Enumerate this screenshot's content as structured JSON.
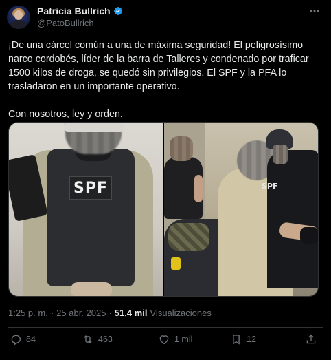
{
  "header": {
    "display_name": "Patricia Bullrich",
    "handle": "@PatoBullrich",
    "verified_icon": "verified-badge-icon",
    "more_icon": "more-horizontal-icon"
  },
  "tweet": {
    "paragraph_1": "¡De una cárcel común a una de máxima seguridad! El peligrosísimo narco cordobés, líder de la barra de Talleres y condenado por traficar 1500 kilos de droga, se quedó sin privilegios. El SPF y la PFA lo trasladaron en un importante operativo.",
    "paragraph_2": "Con nosotros, ley y orden."
  },
  "media": {
    "left_patch_text": "SPF",
    "right_patch_text": "SPF"
  },
  "meta": {
    "time": "1:25 p. m.",
    "separator": "·",
    "date": "25 abr. 2025",
    "separator2": "·",
    "views_count": "51,4 mil",
    "views_label": "Visualizaciones"
  },
  "actions": {
    "reply_count": "84",
    "retweet_count": "463",
    "like_count": "1 mil",
    "bookmark_count": "12"
  },
  "colors": {
    "background": "#000000",
    "text_primary": "#e7e9ea",
    "text_secondary": "#71767b",
    "verified_blue": "#1d9bf0",
    "divider": "#2f3336"
  }
}
